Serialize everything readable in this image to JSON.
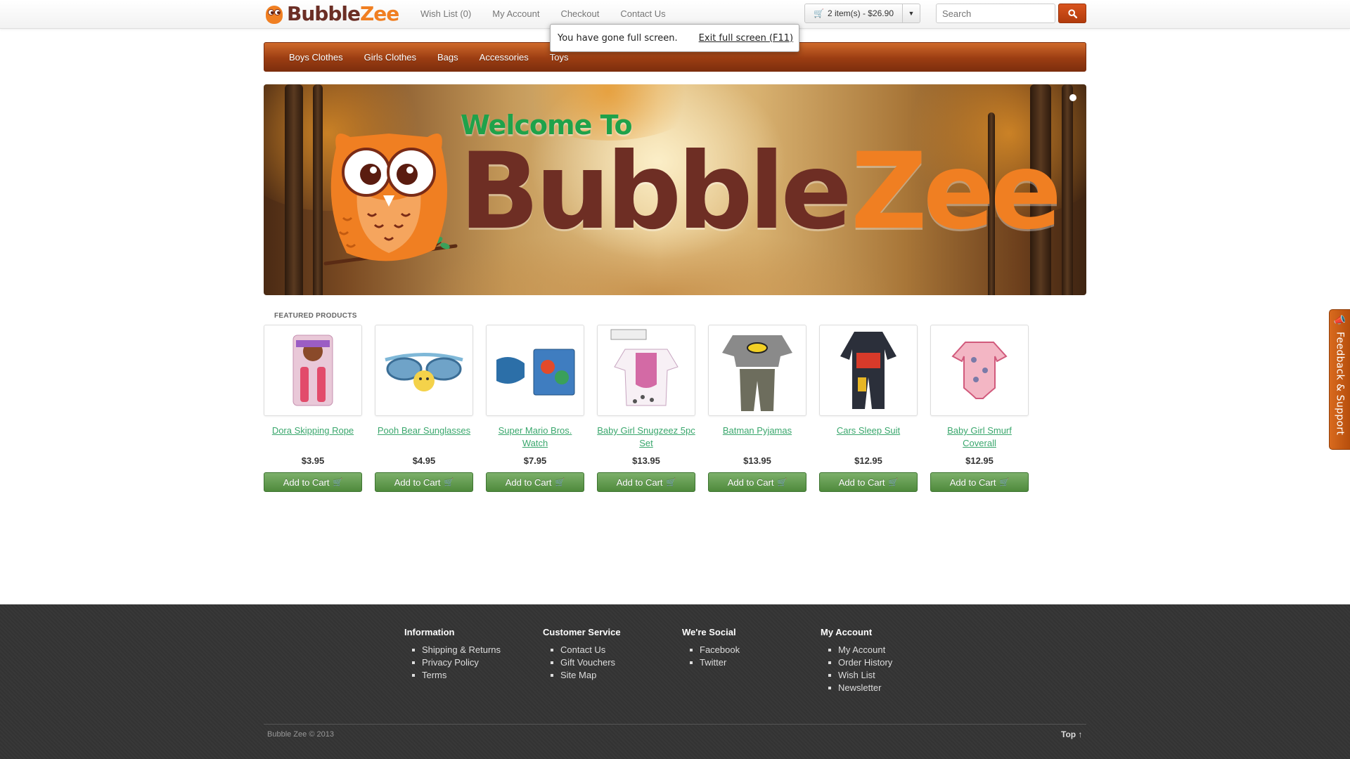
{
  "header": {
    "logo_part1": "Bubble",
    "logo_part2": "Zee",
    "links": [
      "Wish List (0)",
      "My Account",
      "Checkout",
      "Contact Us"
    ],
    "cart_label": "2 item(s) - $26.90",
    "search_placeholder": "Search"
  },
  "fullscreen_notice": {
    "message": "You have gone full screen.",
    "exit_label": "Exit full screen (F11)"
  },
  "nav": {
    "items": [
      "Boys Clothes",
      "Girls Clothes",
      "Bags",
      "Accessories",
      "Toys"
    ]
  },
  "banner": {
    "welcome": "Welcome To",
    "brand1": "Bubble",
    "brand2": "Zee"
  },
  "featured": {
    "title": "FEATURED PRODUCTS",
    "button_label": "Add to Cart",
    "products": [
      {
        "name": "Dora Skipping Rope",
        "price": "$3.95"
      },
      {
        "name": "Pooh Bear Sunglasses",
        "price": "$4.95"
      },
      {
        "name": "Super Mario Bros. Watch",
        "price": "$7.95"
      },
      {
        "name": "Baby Girl Snugzeez 5pc Set",
        "price": "$13.95"
      },
      {
        "name": "Batman Pyjamas",
        "price": "$13.95"
      },
      {
        "name": "Cars Sleep Suit",
        "price": "$12.95"
      },
      {
        "name": "Baby Girl Smurf Coverall",
        "price": "$12.95"
      }
    ]
  },
  "feedback_tab": "Feedback & Support",
  "footer": {
    "columns": [
      {
        "title": "Information",
        "links": [
          "Shipping & Returns",
          "Privacy Policy",
          "Terms"
        ]
      },
      {
        "title": "Customer Service",
        "links": [
          "Contact Us",
          "Gift Vouchers",
          "Site Map"
        ]
      },
      {
        "title": "We're Social",
        "links": [
          "Facebook",
          "Twitter"
        ]
      },
      {
        "title": "My Account",
        "links": [
          "My Account",
          "Order History",
          "Wish List",
          "Newsletter"
        ]
      }
    ],
    "copyright": "Bubble Zee © 2013",
    "top_label": "Top ↑"
  },
  "colors": {
    "brand_orange": "#f07f22",
    "brand_brown": "#6e2e24",
    "nav_brown": "#9b3d12",
    "link_green": "#3aa76d",
    "button_green": "#5f9a4a",
    "footer_bg": "#363636"
  }
}
